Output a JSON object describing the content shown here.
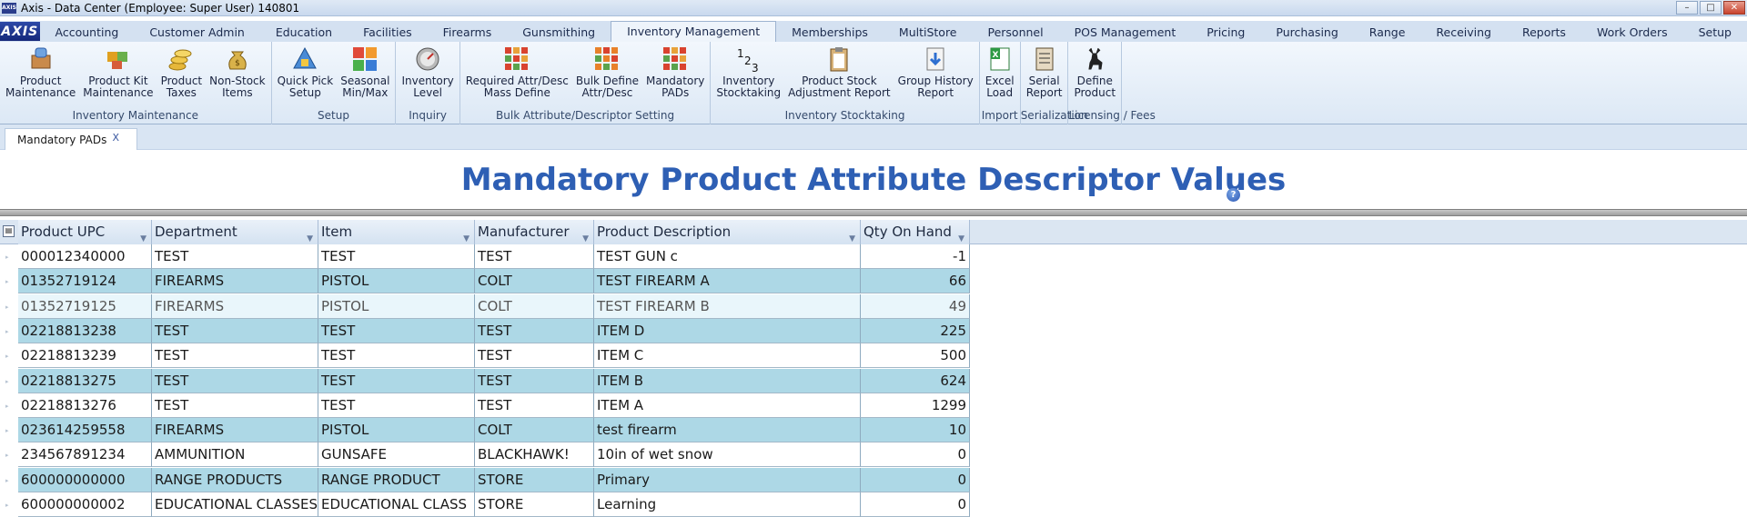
{
  "window": {
    "title": "Axis - Data Center  (Employee: Super User) 140801",
    "logo_text": "AXIS",
    "minimize": "–",
    "maximize": "□",
    "close": "✕"
  },
  "menu": {
    "logo": "AXIS",
    "tabs": [
      "Accounting",
      "Customer Admin",
      "Education",
      "Facilities",
      "Firearms",
      "Gunsmithing",
      "Inventory Management",
      "Memberships",
      "MultiStore",
      "Personnel",
      "POS Management",
      "Pricing",
      "Purchasing",
      "Range",
      "Receiving",
      "Reports",
      "Work Orders",
      "Setup"
    ],
    "active": "Inventory Management"
  },
  "ribbon": {
    "groups": [
      {
        "label": "Inventory Maintenance",
        "buttons": [
          {
            "label": "Product\nMaintenance",
            "icon": "product-box-icon"
          },
          {
            "label": "Product Kit\nMaintenance",
            "icon": "puzzle-icon"
          },
          {
            "label": "Product\nTaxes",
            "icon": "coins-icon"
          },
          {
            "label": "Non-Stock\nItems",
            "icon": "money-bag-icon"
          }
        ]
      },
      {
        "label": "Setup",
        "buttons": [
          {
            "label": "Quick Pick\nSetup",
            "icon": "quick-pick-icon"
          },
          {
            "label": "Seasonal\nMin/Max",
            "icon": "seasons-icon"
          }
        ]
      },
      {
        "label": "Inquiry",
        "buttons": [
          {
            "label": "Inventory\nLevel",
            "icon": "gauge-icon"
          }
        ]
      },
      {
        "label": "Bulk Attribute/Descriptor Setting",
        "buttons": [
          {
            "label": "Required Attr/Desc\nMass Define",
            "icon": "grid-red-icon"
          },
          {
            "label": "Bulk Define\nAttr/Desc",
            "icon": "grid-orange-icon"
          },
          {
            "label": "Mandatory\nPADs",
            "icon": "grid-red-icon"
          }
        ]
      },
      {
        "label": "Inventory Stocktaking",
        "buttons": [
          {
            "label": "Inventory\nStocktaking",
            "icon": "numbers-icon"
          },
          {
            "label": "Product Stock\nAdjustment Report",
            "icon": "clipboard-icon"
          },
          {
            "label": "Group History\nReport",
            "icon": "download-doc-icon"
          }
        ]
      },
      {
        "label": "Import",
        "buttons": [
          {
            "label": "Excel\nLoad",
            "icon": "excel-icon"
          }
        ]
      },
      {
        "label": "Serialization",
        "buttons": [
          {
            "label": "Serial\nReport",
            "icon": "report-icon"
          }
        ]
      },
      {
        "label": "Licensing / Fees",
        "buttons": [
          {
            "label": "Define\nProduct",
            "icon": "deer-icon"
          }
        ]
      }
    ]
  },
  "doc_tab": {
    "label": "Mandatory PADs",
    "close": "X"
  },
  "page": {
    "title": "Mandatory Product Attribute Descriptor Values",
    "help": "?"
  },
  "grid": {
    "columns": [
      "Product UPC",
      "Department",
      "Item",
      "Manufacturer",
      "Product Description",
      "Qty On Hand"
    ],
    "rows": [
      {
        "upc": "000012340000",
        "dept": "TEST",
        "item": "TEST",
        "mfr": "TEST",
        "desc": "TEST GUN c",
        "qty": "-1",
        "style": "white"
      },
      {
        "upc": "01352719124",
        "dept": "FIREARMS",
        "item": "PISTOL",
        "mfr": "COLT",
        "desc": "TEST FIREARM A",
        "qty": "66",
        "style": "alt"
      },
      {
        "upc": "01352719125",
        "dept": "FIREARMS",
        "item": "PISTOL",
        "mfr": "COLT",
        "desc": "TEST FIREARM B",
        "qty": "49",
        "style": "light"
      },
      {
        "upc": "02218813238",
        "dept": "TEST",
        "item": "TEST",
        "mfr": "TEST",
        "desc": "ITEM D",
        "qty": "225",
        "style": "alt"
      },
      {
        "upc": "02218813239",
        "dept": "TEST",
        "item": "TEST",
        "mfr": "TEST",
        "desc": "ITEM C",
        "qty": "500",
        "style": "white"
      },
      {
        "upc": "02218813275",
        "dept": "TEST",
        "item": "TEST",
        "mfr": "TEST",
        "desc": "ITEM B",
        "qty": "624",
        "style": "alt"
      },
      {
        "upc": "02218813276",
        "dept": "TEST",
        "item": "TEST",
        "mfr": "TEST",
        "desc": "ITEM A",
        "qty": "1299",
        "style": "white"
      },
      {
        "upc": "023614259558",
        "dept": "FIREARMS",
        "item": "PISTOL",
        "mfr": "COLT",
        "desc": "test firearm",
        "qty": "10",
        "style": "alt"
      },
      {
        "upc": "234567891234",
        "dept": "AMMUNITION",
        "item": "GUNSAFE",
        "mfr": "BLACKHAWK!",
        "desc": "10in of wet snow",
        "qty": "0",
        "style": "white"
      },
      {
        "upc": "600000000000",
        "dept": "RANGE PRODUCTS",
        "item": "RANGE PRODUCT",
        "mfr": "STORE",
        "desc": "Primary",
        "qty": "0",
        "style": "alt"
      },
      {
        "upc": "600000000002",
        "dept": "EDUCATIONAL CLASSES",
        "item": "EDUCATIONAL CLASS",
        "mfr": "STORE",
        "desc": "Learning",
        "qty": "0",
        "style": "white"
      }
    ]
  },
  "colors": {
    "title": "#2e5fb4",
    "row_alt": "#add8e6",
    "ribbon": "#dce8f5"
  }
}
